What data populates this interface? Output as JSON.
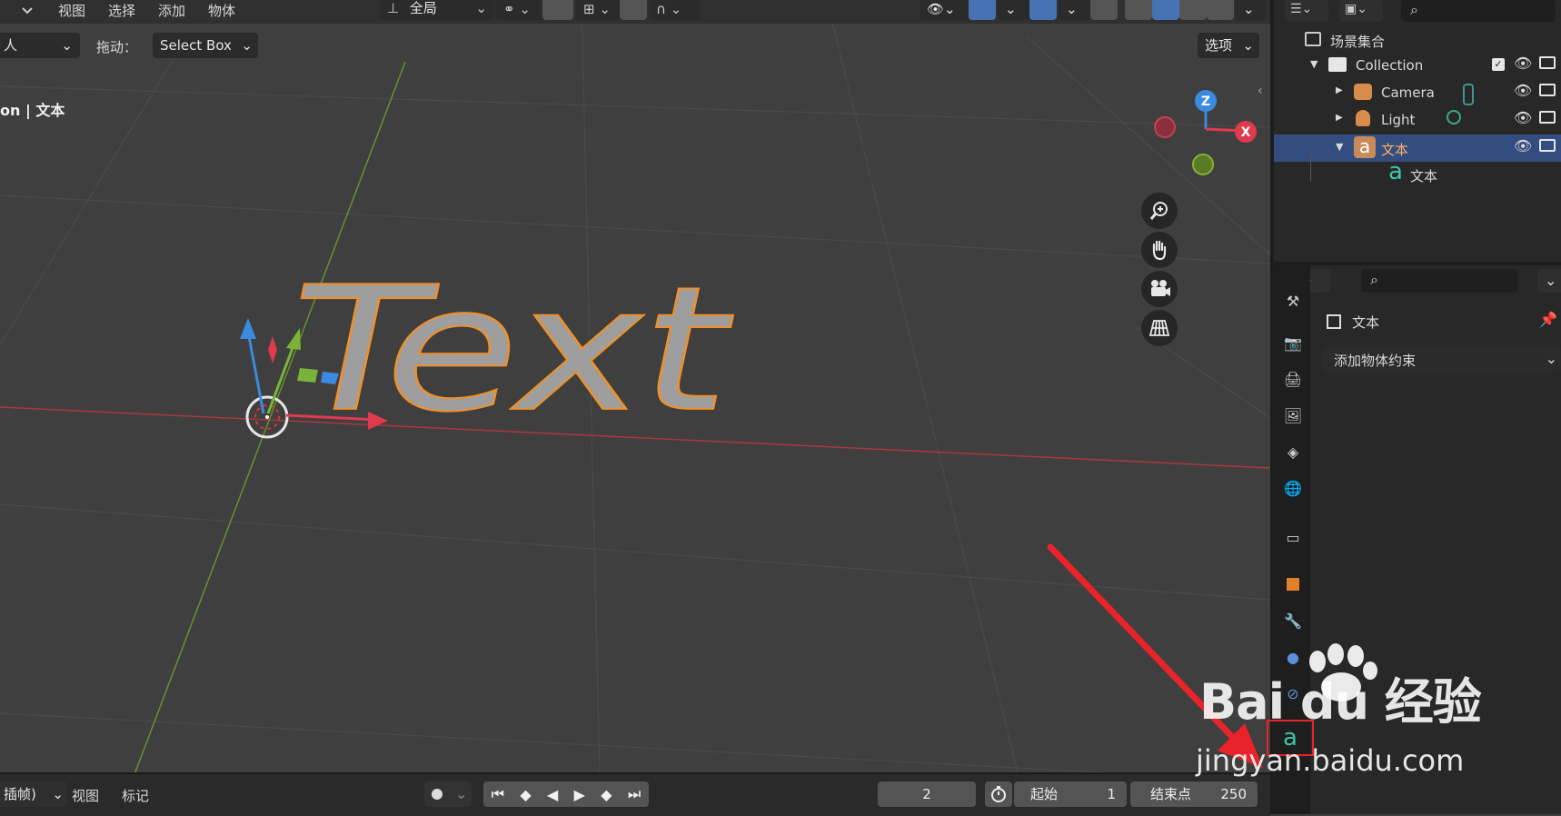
{
  "header": {
    "menu": [
      "视图",
      "选择",
      "添加",
      "物体"
    ],
    "transform_orientation": "全局",
    "mode_fragment": "人",
    "drag_label": "拖动：",
    "drag_value": "Select Box",
    "options_label": "选项"
  },
  "viewport": {
    "overlay_text": "on | 文本",
    "text_object": "Text",
    "gizmo": {
      "z": "Z",
      "x": "X"
    }
  },
  "outliner": {
    "root": "场景集合",
    "collection": "Collection",
    "items": [
      {
        "label": "Camera",
        "icon": "camera-icon"
      },
      {
        "label": "Light",
        "icon": "light-icon"
      },
      {
        "label": "文本",
        "icon": "text-object-icon",
        "selected": true
      },
      {
        "label": "文本",
        "icon": "text-data-icon"
      }
    ]
  },
  "properties": {
    "object_name": "文本",
    "add_constraint": "添加物体约束"
  },
  "timeline": {
    "keying": "插帧)",
    "menu": [
      "视图",
      "标记"
    ],
    "current_frame": "2",
    "start_label": "起始",
    "start_value": "1",
    "end_label": "结束点",
    "end_value": "250"
  },
  "watermark": {
    "brand": "Bai  du 经验",
    "url": "jingyan.baidu.com"
  },
  "colors": {
    "accent_selected": "#3d5a91",
    "object_outline": "#f0902a",
    "annotation_red": "#e8232a",
    "x_axis": "#e03a4e",
    "z_axis": "#3a8ae0",
    "y_axis": "#7ab33a"
  }
}
